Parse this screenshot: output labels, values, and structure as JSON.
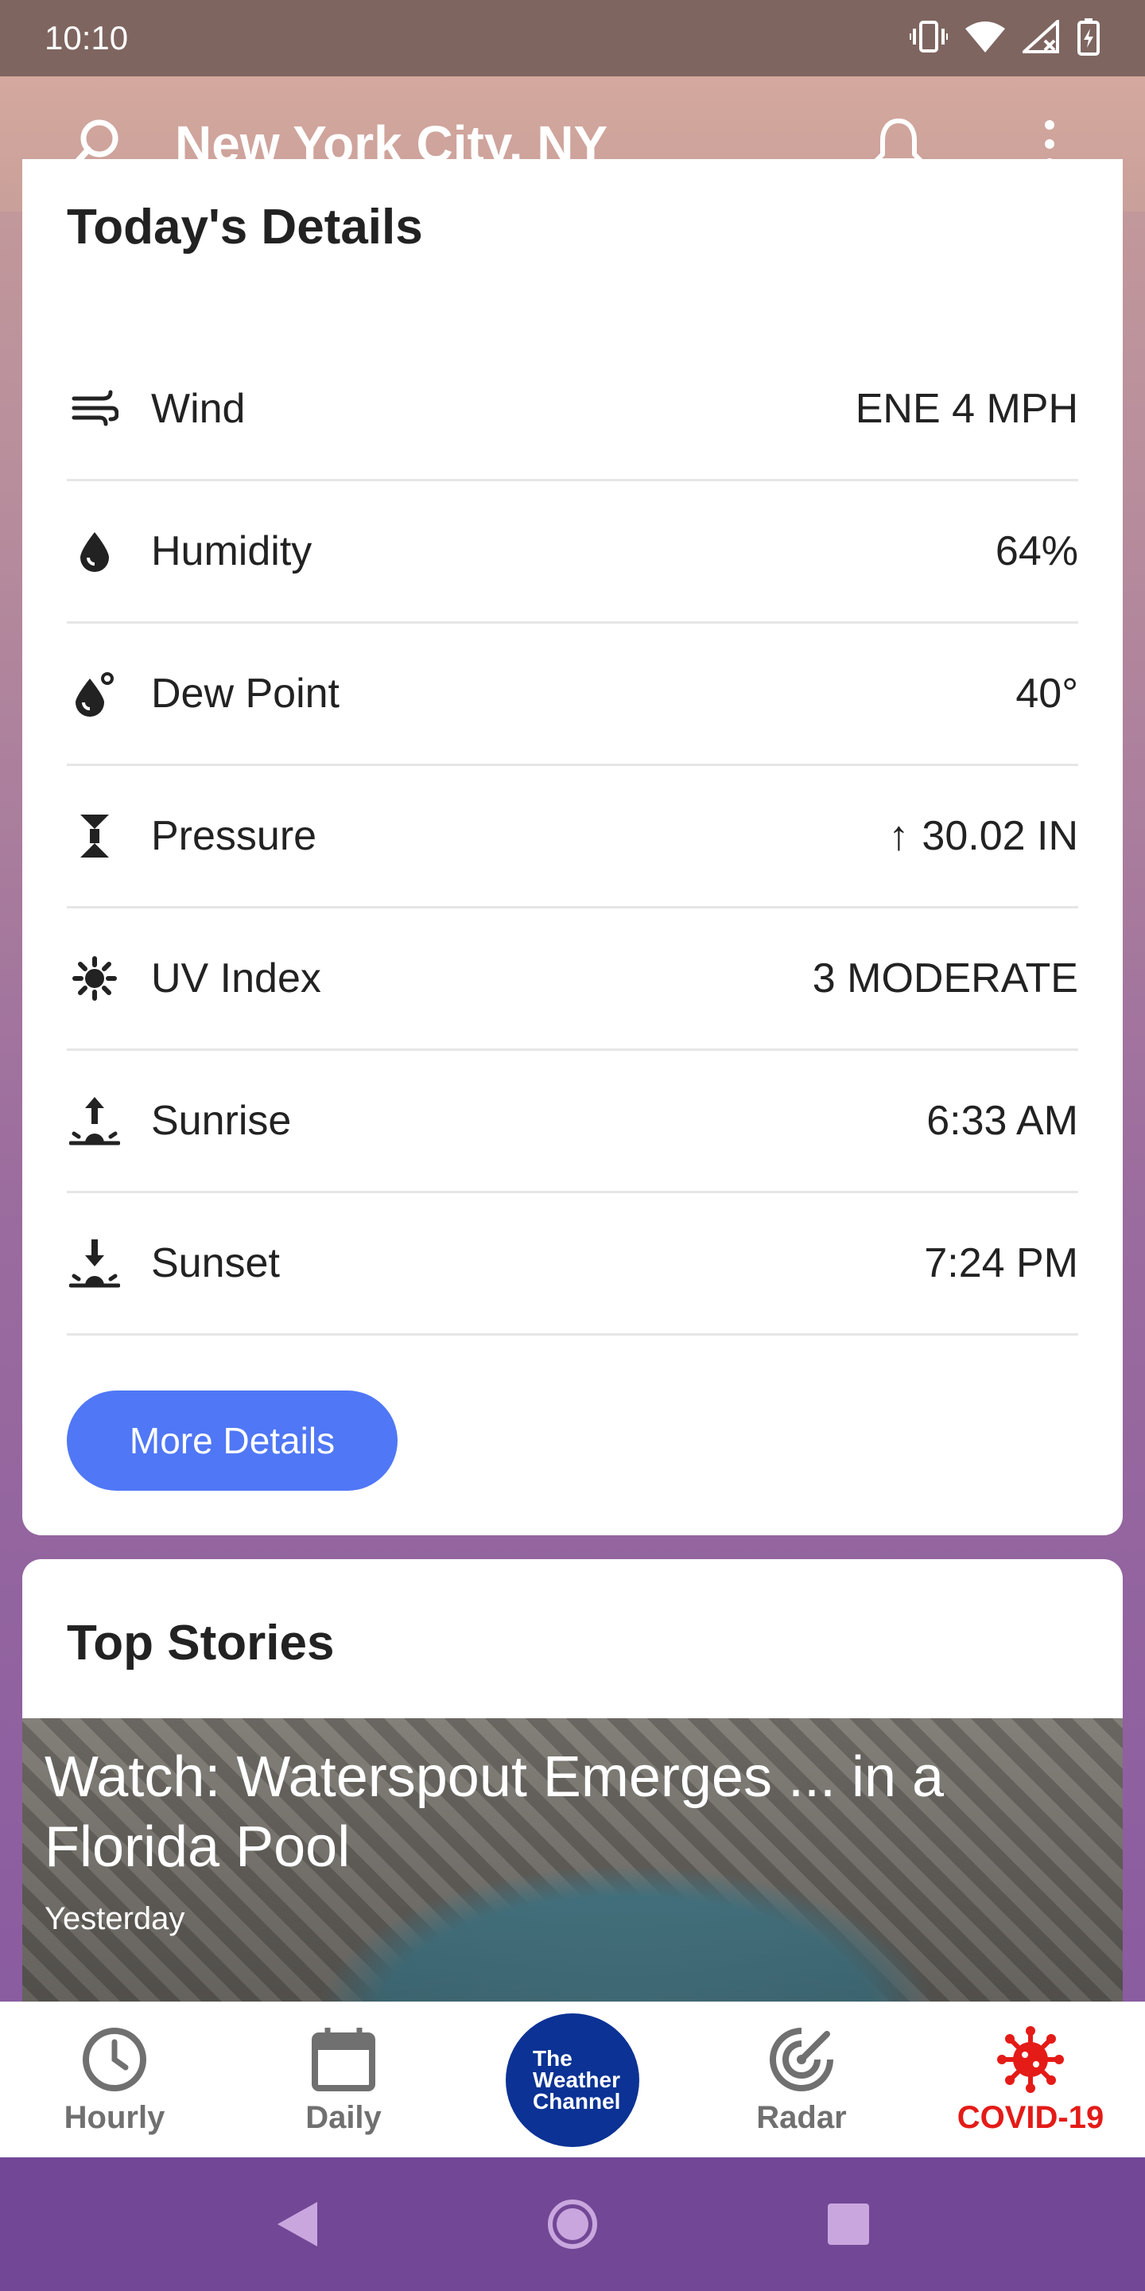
{
  "status_bar": {
    "time": "10:10"
  },
  "app_bar": {
    "location": "New York City, NY"
  },
  "details": {
    "title": "Today's Details",
    "rows": [
      {
        "icon": "wind-icon",
        "label": "Wind",
        "value": "ENE 4 MPH"
      },
      {
        "icon": "humidity-icon",
        "label": "Humidity",
        "value": "64%"
      },
      {
        "icon": "dew-point-icon",
        "label": "Dew Point",
        "value": "40°"
      },
      {
        "icon": "pressure-icon",
        "label": "Pressure",
        "value": "30.02 IN",
        "trend": "↑"
      },
      {
        "icon": "uv-index-icon",
        "label": "UV Index",
        "value": "3 MODERATE"
      },
      {
        "icon": "sunrise-icon",
        "label": "Sunrise",
        "value": "6:33 AM"
      },
      {
        "icon": "sunset-icon",
        "label": "Sunset",
        "value": "7:24 PM"
      }
    ],
    "more_button": "More Details"
  },
  "stories": {
    "title": "Top Stories",
    "headline": "Watch: Waterspout Emerges ... in a Florida Pool",
    "time": "Yesterday"
  },
  "bottom_nav": {
    "hourly": "Hourly",
    "daily": "Daily",
    "logo": [
      "The",
      "Weather",
      "Channel"
    ],
    "radar": "Radar",
    "covid": "COVID-19"
  },
  "colors": {
    "accent_button": "#5077f5",
    "covid_red": "#e41b17",
    "logo_blue": "#0b3294",
    "system_nav": "#724796"
  }
}
